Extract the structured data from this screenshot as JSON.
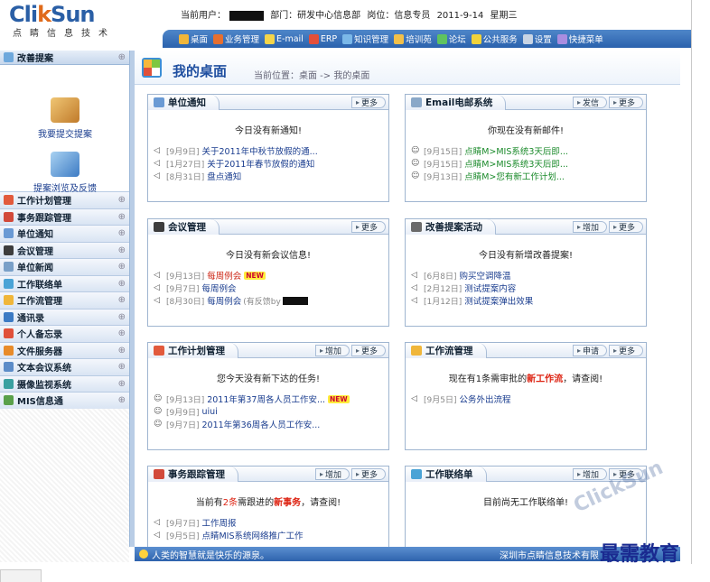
{
  "header": {
    "brand_a": "Cli",
    "brand_b": "k",
    "brand_c": "Sun",
    "brand_sub": "点睛信息技术",
    "user_label": "当前用户：",
    "dept_label": "部门：研发中心信息部",
    "post_label": "岗位：信息专员",
    "date": "2011-9-14",
    "weekday": "星期三"
  },
  "nav": [
    {
      "label": "桌面",
      "icon": "desktop-icon",
      "color": "#f0b63a"
    },
    {
      "label": "业务管理",
      "icon": "person-icon",
      "color": "#e66f2f"
    },
    {
      "label": "E-mail",
      "icon": "mail-icon",
      "color": "#f4d54a"
    },
    {
      "label": "ERP",
      "icon": "erp-icon",
      "color": "#e34f3a"
    },
    {
      "label": "知识管理",
      "icon": "knowledge-icon",
      "color": "#7bb8e8"
    },
    {
      "label": "培训苑",
      "icon": "training-icon",
      "color": "#f2c04a"
    },
    {
      "label": "论坛",
      "icon": "forum-icon",
      "color": "#5fc35f"
    },
    {
      "label": "公共服务",
      "icon": "service-icon",
      "color": "#f0d23a"
    },
    {
      "label": "设置",
      "icon": "settings-icon",
      "color": "#c8d4e4"
    },
    {
      "label": "快捷菜单",
      "icon": "shortcut-icon",
      "color": "#a98de0"
    }
  ],
  "sidebar": {
    "title": "改善提案",
    "dots": "⊕",
    "cards": [
      {
        "label": "我要提交提案",
        "color": "#f0c674"
      },
      {
        "label": "提案浏览及反馈",
        "color": "#6ea8dc"
      }
    ],
    "items": [
      {
        "label": "工作计划管理",
        "color": "#e25a3c"
      },
      {
        "label": "事务跟踪管理",
        "color": "#d24a3a"
      },
      {
        "label": "单位通知",
        "color": "#6a9ad4"
      },
      {
        "label": "会议管理",
        "color": "#3d3d3d"
      },
      {
        "label": "单位新闻",
        "color": "#7aa0c8"
      },
      {
        "label": "工作联络单",
        "color": "#4aa3d6"
      },
      {
        "label": "工作流管理",
        "color": "#f0b63a"
      },
      {
        "label": "通讯录",
        "color": "#3d7bc4"
      },
      {
        "label": "个人备忘录",
        "color": "#e0503a"
      },
      {
        "label": "文件服务器",
        "color": "#e88b2a"
      },
      {
        "label": "文本会议系统",
        "color": "#5c8cc8"
      },
      {
        "label": "摄像监视系统",
        "color": "#3aa0a0"
      },
      {
        "label": "MIS信息通",
        "color": "#5aa04a"
      }
    ]
  },
  "main": {
    "title": "我的桌面",
    "location": "当前位置：桌面 -> 我的桌面"
  },
  "panels": [
    {
      "title": "单位通知",
      "color": "#6a9ad4",
      "actions": [
        "更多"
      ],
      "msg": "今日没有新通知!",
      "rows": [
        {
          "date": "[9月9日]",
          "text": "关于2011年中秋节放假的通...",
          "style": ""
        },
        {
          "date": "[1月27日]",
          "text": "关于2011年春节放假的通知",
          "style": ""
        },
        {
          "date": "[8月31日]",
          "text": "盘点通知",
          "style": ""
        }
      ]
    },
    {
      "title": "Email电邮系统",
      "color": "#8aa8c8",
      "actions": [
        "发信",
        "更多"
      ],
      "msg": "你现在没有新邮件!",
      "rows": [
        {
          "date": "[9月15日]",
          "text": "点睛M>MIS系统3天后即...",
          "style": "green"
        },
        {
          "date": "[9月15日]",
          "text": "点睛M>MIS系统3天后即...",
          "style": "green"
        },
        {
          "date": "[9月13日]",
          "text": "点睛M>您有新工作计划...",
          "style": "green"
        }
      ]
    },
    {
      "title": "会议管理",
      "color": "#3d3d3d",
      "actions": [
        "更多"
      ],
      "msg": "今日没有新会议信息!",
      "rows": [
        {
          "date": "[9月13日]",
          "text": "每周例会",
          "style": "red",
          "badge": "NEW"
        },
        {
          "date": "[9月7日]",
          "text": "每周例会",
          "style": ""
        },
        {
          "date": "[8月30日]",
          "text": "每周例会",
          "style": "",
          "note": "(有反馈by"
        }
      ]
    },
    {
      "title": "改善提案活动",
      "color": "#6a6a6a",
      "actions": [
        "增加",
        "更多"
      ],
      "msg": "今日没有新增改善提案!",
      "rows": [
        {
          "date": "[6月8日]",
          "text": "购买空调降温",
          "style": ""
        },
        {
          "date": "[2月12日]",
          "text": "测试提案内容",
          "style": ""
        },
        {
          "date": "[1月12日]",
          "text": "测试提案弹出效果",
          "style": ""
        }
      ]
    },
    {
      "title": "工作计划管理",
      "color": "#e25a3c",
      "actions": [
        "增加",
        "更多"
      ],
      "msg": "您今天没有新下达的任务!",
      "rows": [
        {
          "date": "[9月13日]",
          "text": "2011年第37周各人员工作安...",
          "style": "",
          "badge": "NEW"
        },
        {
          "date": "[9月9日]",
          "text": "uiui",
          "style": ""
        },
        {
          "date": "[9月7日]",
          "text": "2011年第36周各人员工作安...",
          "style": ""
        }
      ]
    },
    {
      "title": "工作流管理",
      "color": "#f0b63a",
      "actions": [
        "申请",
        "更多"
      ],
      "msg_a": "现在有1条需审批的",
      "msg_b": "新工作流",
      "msg_c": "，请查阅!",
      "rows": [
        {
          "date": "[9月5日]",
          "text": "公务外出流程",
          "style": ""
        }
      ]
    },
    {
      "title": "事务跟踪管理",
      "color": "#d24a3a",
      "actions": [
        "增加",
        "更多"
      ],
      "msg_a": "当前有",
      "msg_n": "2条",
      "msg_b": "需跟进的",
      "msg_c": "新事务",
      "msg_d": "，请查阅!",
      "rows": [
        {
          "date": "[9月7日]",
          "text": "工作周报",
          "style": ""
        },
        {
          "date": "[9月5日]",
          "text": "点睛MIS系统网络推广工作",
          "style": ""
        }
      ]
    },
    {
      "title": "工作联络单",
      "color": "#4aa3d6",
      "actions": [
        "增加",
        "更多"
      ],
      "msg": "目前尚无工作联络单!",
      "rows": []
    }
  ],
  "footer": {
    "motto": "人类的智慧就是快乐的源泉。",
    "copyright": "深圳市点睛信息技术有限"
  },
  "watermark": {
    "text": "最需教育",
    "logo": "ClickSun"
  }
}
